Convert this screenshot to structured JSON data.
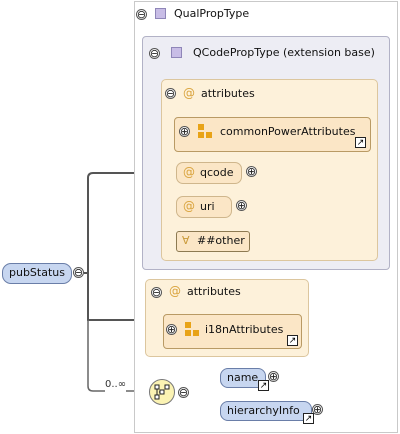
{
  "root": {
    "label": "pubStatus"
  },
  "type": {
    "name": "QualPropType",
    "base": {
      "name": "QCodePropType (extension base)",
      "attributes": {
        "header": "attributes",
        "group": "commonPowerAttributes",
        "qcode": "qcode",
        "uri": "uri",
        "other": "##other"
      }
    },
    "attributes": {
      "header": "attributes",
      "group": "i18nAttributes"
    },
    "sequence": {
      "cardinality": "0..∞",
      "elements": [
        "name",
        "hierarchyInfo"
      ]
    }
  },
  "icons": {
    "toggle_collapse": "⊖",
    "toggle_expand": "⊕",
    "attribute": "@",
    "any_attribute": "∀",
    "link": "↗",
    "sequence": "sequence-compositor-icon",
    "complex_type": "complex-type-square-icon",
    "attribute_group": "attribute-group-icon"
  },
  "colors": {
    "attr_fill": "#fdf1da",
    "base_fill": "#ededf4",
    "element_fill": "#c7d6f0",
    "at_sign": "#d9a33c",
    "compositor": "#fbf3b3"
  }
}
